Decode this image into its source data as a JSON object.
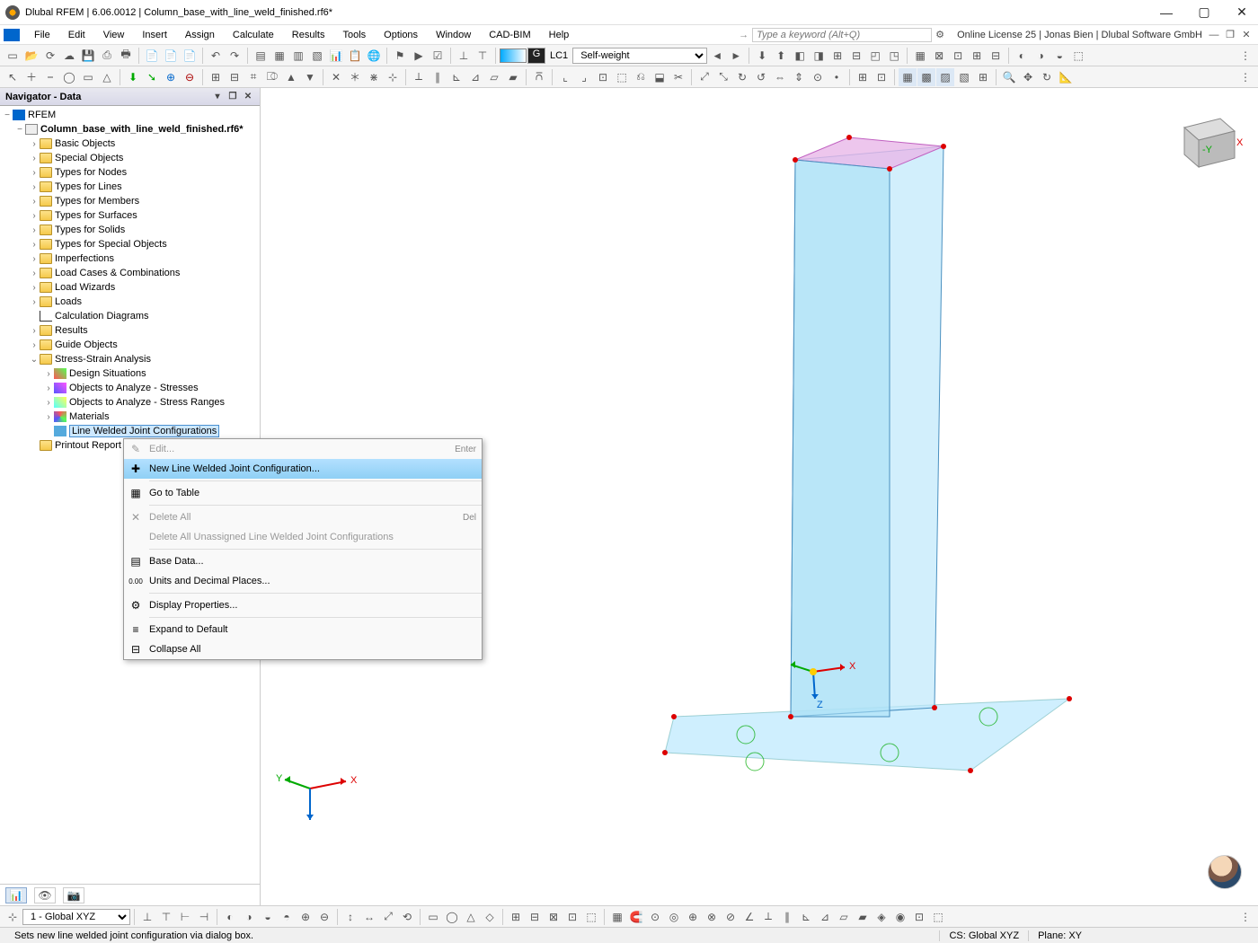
{
  "title": "Dlubal RFEM | 6.06.0012 | Column_base_with_line_weld_finished.rf6*",
  "menus": [
    "File",
    "Edit",
    "View",
    "Insert",
    "Assign",
    "Calculate",
    "Results",
    "Tools",
    "Options",
    "Window",
    "CAD-BIM",
    "Help"
  ],
  "search_placeholder": "Type a keyword (Alt+Q)",
  "license": "Online License 25 | Jonas Bien | Dlubal Software GmbH",
  "lc_label": "LC1",
  "lc_combo": "Self-weight",
  "lc_g": "G",
  "nav_title": "Navigator - Data",
  "tree": {
    "root": "RFEM",
    "project": "Column_base_with_line_weld_finished.rf6*",
    "items": [
      "Basic Objects",
      "Special Objects",
      "Types for Nodes",
      "Types for Lines",
      "Types for Members",
      "Types for Surfaces",
      "Types for Solids",
      "Types for Special Objects",
      "Imperfections",
      "Load Cases & Combinations",
      "Load Wizards",
      "Loads",
      "Calculation Diagrams",
      "Results",
      "Guide Objects"
    ],
    "stress": "Stress-Strain Analysis",
    "stress_items": [
      "Design Situations",
      "Objects to Analyze - Stresses",
      "Objects to Analyze - Stress Ranges",
      "Materials"
    ],
    "selected": "Line Welded Joint Configurations",
    "printout": "Printout Report"
  },
  "ctx": {
    "edit": "Edit...",
    "edit_sc": "Enter",
    "new": "New Line Welded Joint Configuration...",
    "goto": "Go to Table",
    "del": "Delete All",
    "del_sc": "Del",
    "del_un": "Delete All Unassigned Line Welded Joint Configurations",
    "base": "Base Data...",
    "units": "Units and Decimal Places...",
    "disp": "Display Properties...",
    "expand": "Expand to Default",
    "collapse": "Collapse All"
  },
  "status": {
    "hint": "Sets new line welded joint configuration via dialog box.",
    "cs": "CS: Global XYZ",
    "plane": "Plane: XY",
    "combo": "1 - Global XYZ"
  },
  "axes": {
    "x": "X",
    "y": "Y",
    "z": "Z",
    "my": "-Y"
  }
}
